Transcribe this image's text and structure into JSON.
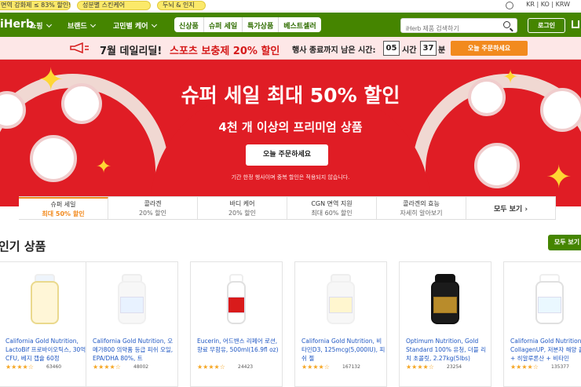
{
  "topbar": {
    "pills": [
      "면역 강화제 ≤ 83% 할인!",
      "성분별 스킨케어",
      "두뇌 & 인지"
    ],
    "locale": "KR | KO | KRW"
  },
  "header": {
    "logo": "iHerb",
    "menu": [
      "쇼핑",
      "브랜드",
      "고민별 케어"
    ],
    "chips": [
      "신상품",
      "슈퍼 세일",
      "특가상품",
      "베스트셀러"
    ],
    "search_placeholder": "iHerb 제품 검색하기",
    "login": "로그인"
  },
  "promo": {
    "title": "7월 데일리딜!",
    "highlight": "스포츠 보충제 20% 할인",
    "timer_label": "행사 종료까지 남은 시간:",
    "hours": "05",
    "hour_unit": "시간",
    "minutes": "37",
    "minute_unit": "분",
    "button": "오늘 주문하세요"
  },
  "hero": {
    "title": "슈퍼 세일 최대 50% 할인",
    "subtitle": "4천 개 이상의 프리미엄 상품",
    "cta": "오늘 주문하세요",
    "note": "기간 한정 행사이며 중복 할인은 적용되지 않습니다."
  },
  "tabs": [
    {
      "label": "슈퍼 세일",
      "sub": "최대 50% 할인"
    },
    {
      "label": "콜라겐",
      "sub": "20% 할인"
    },
    {
      "label": "바디 케어",
      "sub": "20% 할인"
    },
    {
      "label": "CGN 면역 지원",
      "sub": "최대 60% 할인"
    },
    {
      "label": "콜라겐의 효능",
      "sub": "자세히 알아보기"
    }
  ],
  "tabs_more": "모두 보기",
  "section": {
    "title": "인기 상품",
    "see_all": "모두 보기"
  },
  "products": [
    {
      "name": "California Gold Nutrition, LactoBif 프로바이오틱스, 30억 CFU, 베지 캡슐 60정",
      "rating": "4.5",
      "count": "63460"
    },
    {
      "name": "California Gold Nutrition, 오메가800 의약품 등급 피쉬 오일, EPA/DHA 80%, 트",
      "rating": "4.5",
      "count": "48002"
    },
    {
      "name": "Eucerin, 어드밴스 리페어 로션, 향료 무함유, 500ml(16.9fl oz)",
      "rating": "4.5",
      "count": "24423"
    },
    {
      "name": "California Gold Nutrition, 비타민D3, 125mcg(5,000IU), 피쉬 젤",
      "rating": "4.5",
      "count": "167132"
    },
    {
      "name": "Optimum Nutrition, Gold Standard 100% 유청, 더블 리치 초콜릿, 2.27kg(5lbs)",
      "rating": "4.5",
      "count": "23254"
    },
    {
      "name": "California Gold Nutrition, CollagenUP, 저분자 해양 콜라겐 + 히알루론산 + 비타민",
      "rating": "4.5",
      "count": "135377"
    }
  ]
}
